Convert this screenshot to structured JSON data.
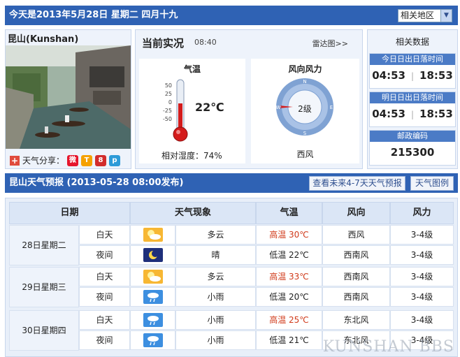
{
  "header": {
    "date_text": "今天是2013年5月28日 星期二 四月十九",
    "region_select": "相关地区"
  },
  "city": {
    "name": "昆山(Kunshan)",
    "share_label": "天气分享："
  },
  "now": {
    "title": "当前实况",
    "time": "08:40",
    "radar_link": "雷达图>>",
    "temp_title": "气温",
    "temp_value": "22℃",
    "scale": [
      "50",
      "25",
      "0",
      "-25",
      "-50"
    ],
    "humidity_label": "相对湿度：",
    "humidity_value": "74%",
    "wind_title": "风向风力",
    "wind_level": "2级",
    "wind_dir": "西风",
    "compass": {
      "n": "N",
      "e": "E",
      "s": "S",
      "w": "W"
    }
  },
  "related": {
    "title": "相关数据",
    "today_label": "今日日出日落时间",
    "today_sunrise": "04:53",
    "today_sunset": "18:53",
    "tomorrow_label": "明日日出日落时间",
    "tomorrow_sunrise": "04:53",
    "tomorrow_sunset": "18:53",
    "postcode_label": "邮政编码",
    "postcode": "215300"
  },
  "forecast": {
    "title": "昆山天气预报 (2013-05-28  08:00发布)",
    "btn_more": "查看未来4-7天天气预报",
    "btn_legend": "天气图例",
    "columns": [
      "日期",
      "天气现象",
      "气温",
      "风向",
      "风力"
    ],
    "days": [
      {
        "date": "28日星期二",
        "day": {
          "label": "白天",
          "icon": "partly-cloudy-icon",
          "weather": "多云",
          "temp": "高温 30℃",
          "wind_dir": "西风",
          "wind_force": "3-4级"
        },
        "night": {
          "label": "夜间",
          "icon": "moon-icon",
          "weather": "晴",
          "temp": "低温 22℃",
          "wind_dir": "西南风",
          "wind_force": "3-4级"
        }
      },
      {
        "date": "29日星期三",
        "day": {
          "label": "白天",
          "icon": "partly-cloudy-icon",
          "weather": "多云",
          "temp": "高温 33℃",
          "wind_dir": "西南风",
          "wind_force": "3-4级"
        },
        "night": {
          "label": "夜间",
          "icon": "light-rain-icon",
          "weather": "小雨",
          "temp": "低温 20℃",
          "wind_dir": "西南风",
          "wind_force": "3-4级"
        }
      },
      {
        "date": "30日星期四",
        "day": {
          "label": "白天",
          "icon": "light-rain-icon",
          "weather": "小雨",
          "temp": "高温 25℃",
          "wind_dir": "东北风",
          "wind_force": "3-4级"
        },
        "night": {
          "label": "夜间",
          "icon": "light-rain-icon",
          "weather": "小雨",
          "temp": "低温 21℃",
          "wind_dir": "东北风",
          "wind_force": "3-4级"
        }
      }
    ]
  },
  "watermark": "KUNSHAN BBS"
}
